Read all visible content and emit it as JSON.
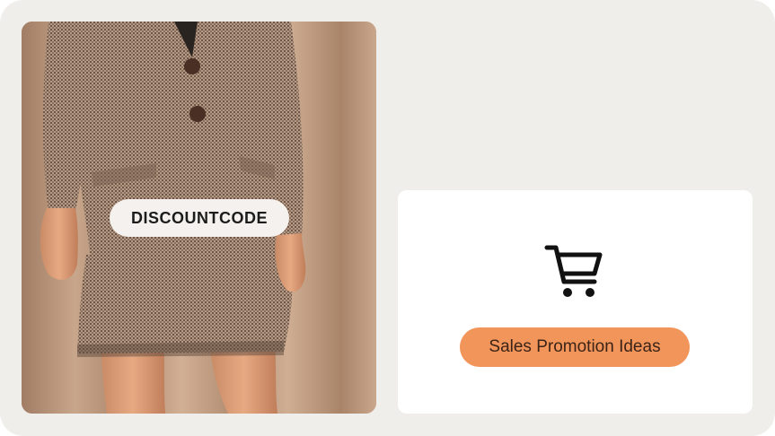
{
  "photo": {
    "alt_subject": "model-in-houndstooth-blazer-and-skirt",
    "code_label": "DISCOUNTCODE"
  },
  "promo": {
    "icon": "shopping-cart-icon",
    "button_label": "Sales Promotion Ideas"
  },
  "colors": {
    "background": "#efeeeb",
    "accent": "#f2955a",
    "card": "#ffffff"
  }
}
